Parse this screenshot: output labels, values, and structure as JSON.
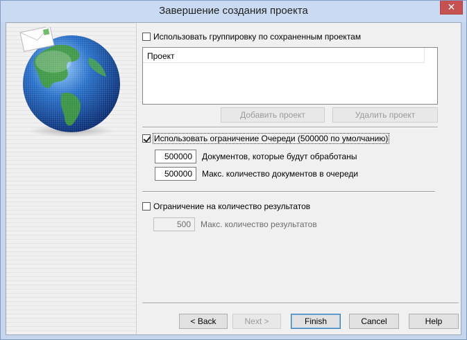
{
  "window": {
    "title": "Завершение создания проекта",
    "close_glyph": "✕"
  },
  "sidebar": {
    "image_icon": "globe-with-envelope-icon"
  },
  "grouping": {
    "checkbox_label": "Использовать группировку по сохраненным проектам",
    "checked": false,
    "list_header": "Проект",
    "add_button": "Добавить проект",
    "remove_button": "Удалить проект"
  },
  "queue": {
    "checkbox_label": "Использовать ограничение Очереди (500000 по умолчанию)",
    "checked": true,
    "docs_processed_value": "500000",
    "docs_processed_label": "Документов, которые будут обработаны",
    "max_queue_value": "500000",
    "max_queue_label": "Макс. количество документов в очереди"
  },
  "results": {
    "checkbox_label": "Ограничение на количество результатов",
    "checked": false,
    "max_results_value": "500",
    "max_results_label": "Макс. количество результатов"
  },
  "footer": {
    "back": "< Back",
    "next": "Next >",
    "finish": "Finish",
    "cancel": "Cancel",
    "help": "Help"
  },
  "colors": {
    "title_bar": "#c9daf2",
    "close_button": "#c75050",
    "dialog_bg": "#f0f0f0"
  }
}
